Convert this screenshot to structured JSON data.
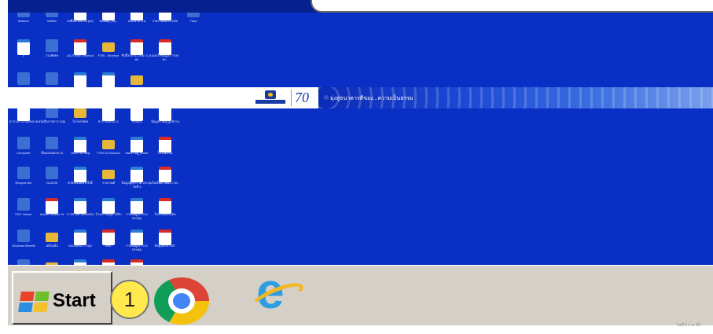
{
  "banner": {
    "anniversary": "70",
    "tagline": "มุ่งสู่ธนาคารดีของ...ความเป็นธรรม"
  },
  "desktop_icons": [
    {
      "label": "ttrameu",
      "kind": "app"
    },
    {
      "label": "krittew",
      "kind": "app"
    },
    {
      "label": "ลงพื้นที่วันที่ 18 (bk)",
      "kind": "word"
    },
    {
      "label": "Neutap_mq..",
      "kind": "word"
    },
    {
      "label": "แนะนำตัวใน",
      "kind": "word"
    },
    {
      "label": "รายงานผลประกอบ",
      "kind": "excel"
    },
    {
      "label": "Tuna",
      "kind": "app"
    },
    {
      "label": "ll",
      "kind": "word"
    },
    {
      "label": "งานพิเศษ",
      "kind": "app"
    },
    {
      "label": "แนวโทนที่ Shortcut",
      "kind": "pdf"
    },
    {
      "label": "FOB - Shortcut",
      "kind": "folder"
    },
    {
      "label": "ชิปปิ้งลงวัน OSN 11-5-60",
      "kind": "pdf"
    },
    {
      "label": "แบบใบข้อมูล การลงทะ..",
      "kind": "pdf"
    },
    {
      "label": "",
      "kind": "app"
    },
    {
      "label": "",
      "kind": "app"
    },
    {
      "label": "",
      "kind": "word"
    },
    {
      "label": "",
      "kind": "word"
    },
    {
      "label": "",
      "kind": "folder"
    },
    {
      "label": "ตารางงาน ของหน่วย",
      "kind": "word"
    },
    {
      "label": "หนังสือราชการ กลุ่ม",
      "kind": "app"
    },
    {
      "label": "ไมโครซอฟ",
      "kind": "folder"
    },
    {
      "label": "ตารางอบรม 11",
      "kind": "word"
    },
    {
      "label": "ค่าเดิน",
      "kind": "word"
    },
    {
      "label": "ข้อมูลสำคัญ ผู้ใช้งาน",
      "kind": "pdf"
    },
    {
      "label": "Computer",
      "kind": "app"
    },
    {
      "label": "ขั้นตอนพนักงาน",
      "kind": "app"
    },
    {
      "label": "เอกสารสำคัญ",
      "kind": "word"
    },
    {
      "label": "รายงาน Shortcut",
      "kind": "folder"
    },
    {
      "label": "Save Log_reuter",
      "kind": "word"
    },
    {
      "label": "ไม่ได้ตั้งชื่อ",
      "kind": "pdf"
    },
    {
      "label": "Recycle Bin",
      "kind": "app"
    },
    {
      "label": "GL2000",
      "kind": "app"
    },
    {
      "label": "ฝ่ายทะเบียน ครั้งนี้",
      "kind": "word"
    },
    {
      "label": "รายงานดี",
      "kind": "folder"
    },
    {
      "label": "ข้อมูลผู้เข้าร่วม ประชุมวันที่ 3",
      "kind": "word"
    },
    {
      "label": "ใบเรียน Test1-7 60",
      "kind": "pdf"
    },
    {
      "label": "PDF Viewer",
      "kind": "app"
    },
    {
      "label": "Adobe Reader XI",
      "kind": "pdf"
    },
    {
      "label": "การจ่ายค่าตอบแทน",
      "kind": "word"
    },
    {
      "label": "จ้าง/ค่าข้อมูล ได้รับ",
      "kind": "word"
    },
    {
      "label": "รายชื่อผู้เข้าร่วม ประชุม",
      "kind": "word"
    },
    {
      "label": "ใบรับลงทะเบียน",
      "kind": "pdf"
    },
    {
      "label": "Shoboss Benefit",
      "kind": "app"
    },
    {
      "label": "เครื่องมือ",
      "kind": "folder"
    },
    {
      "label": "แบบฟอร์ม 7-กลุ่ม",
      "kind": "word"
    },
    {
      "label": "สพส.",
      "kind": "pdf"
    },
    {
      "label": "รายชื่อผู้เข้าร่วม ประชุม",
      "kind": "word"
    },
    {
      "label": "ข้อมูลผลการดำ",
      "kind": "pdf"
    },
    {
      "label": "",
      "kind": "app"
    },
    {
      "label": "",
      "kind": "folder"
    },
    {
      "label": "",
      "kind": "word"
    },
    {
      "label": "",
      "kind": "pdf"
    },
    {
      "label": "",
      "kind": "pdf"
    }
  ],
  "taskbar": {
    "start_label": "Start",
    "step_number": "1",
    "clock": "วันที่ 1 ก.ย. 60"
  },
  "colors": {
    "desktop": "#0a2fc4",
    "taskbar": "#d4d0c8",
    "badge": "#ffe94d"
  }
}
